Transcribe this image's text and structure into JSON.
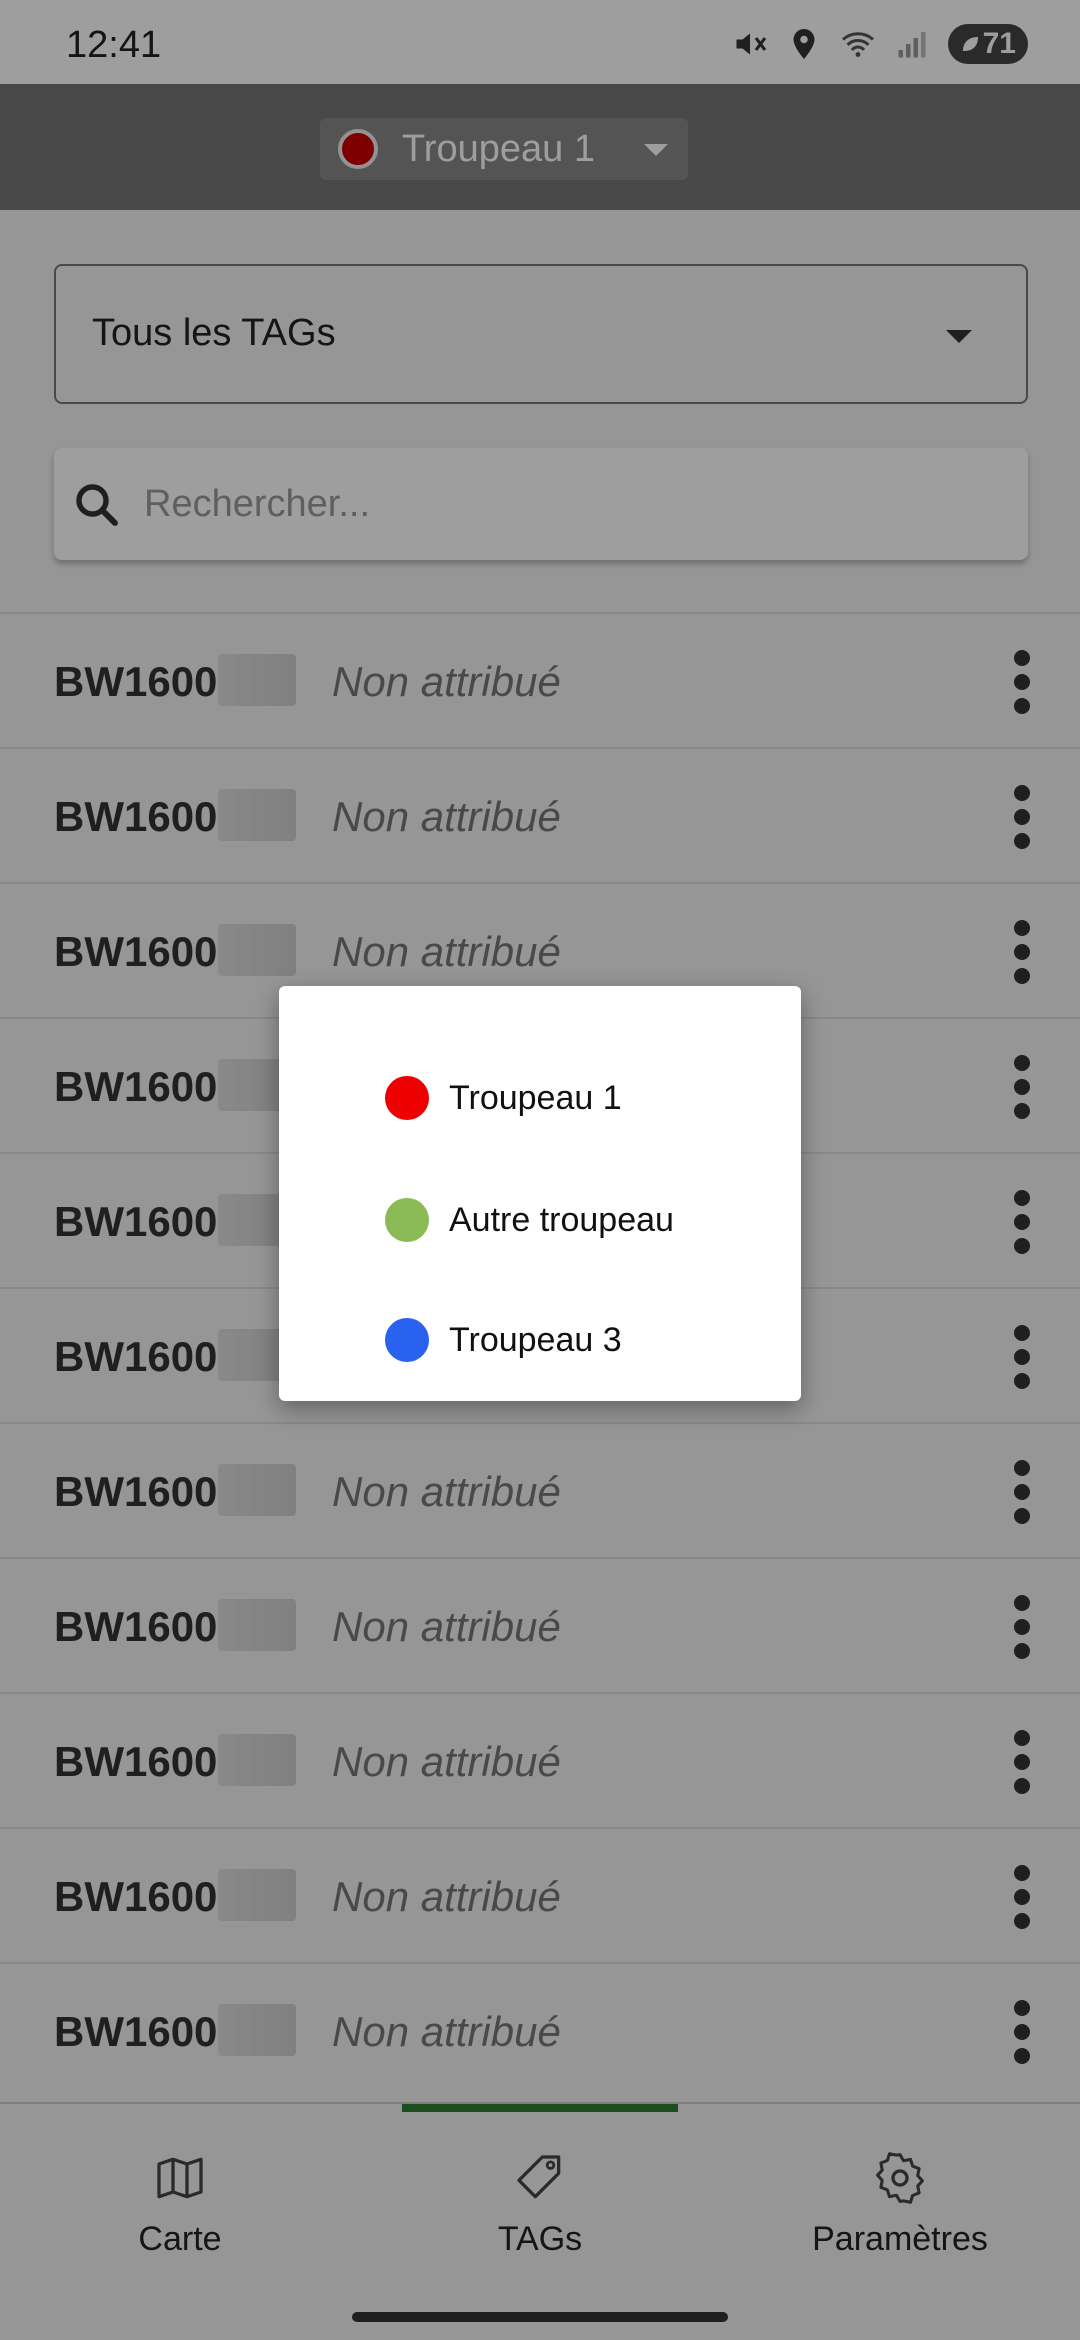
{
  "status_bar": {
    "time": "12:41",
    "battery": "71"
  },
  "header": {
    "selected_herd": "Troupeau 1",
    "selected_herd_color": "#cc0000"
  },
  "filter": {
    "value": "Tous les TAGs"
  },
  "search": {
    "placeholder": "Rechercher..."
  },
  "tags": [
    {
      "id": "BW1600",
      "status": "Non attribué"
    },
    {
      "id": "BW1600",
      "status": "Non attribué"
    },
    {
      "id": "BW1600",
      "status": "Non attribué"
    },
    {
      "id": "BW1600",
      "status": ""
    },
    {
      "id": "BW1600",
      "status": ""
    },
    {
      "id": "BW1600",
      "status": ""
    },
    {
      "id": "BW1600",
      "status": "Non attribué"
    },
    {
      "id": "BW1600",
      "status": "Non attribué"
    },
    {
      "id": "BW1600",
      "status": "Non attribué"
    },
    {
      "id": "BW1600",
      "status": "Non attribué"
    },
    {
      "id": "BW1600",
      "status": "Non attribué"
    }
  ],
  "herd_dialog": {
    "options": [
      {
        "label": "Troupeau 1",
        "color": "#ee0000"
      },
      {
        "label": "Autre troupeau",
        "color": "#8bbb55"
      },
      {
        "label": "Troupeau 3",
        "color": "#2962ee"
      }
    ]
  },
  "bottom_nav": {
    "items": [
      {
        "label": "Carte",
        "icon": "map-icon"
      },
      {
        "label": "TAGs",
        "icon": "tag-icon"
      },
      {
        "label": "Paramètres",
        "icon": "gear-icon"
      }
    ],
    "active": "TAGs"
  }
}
